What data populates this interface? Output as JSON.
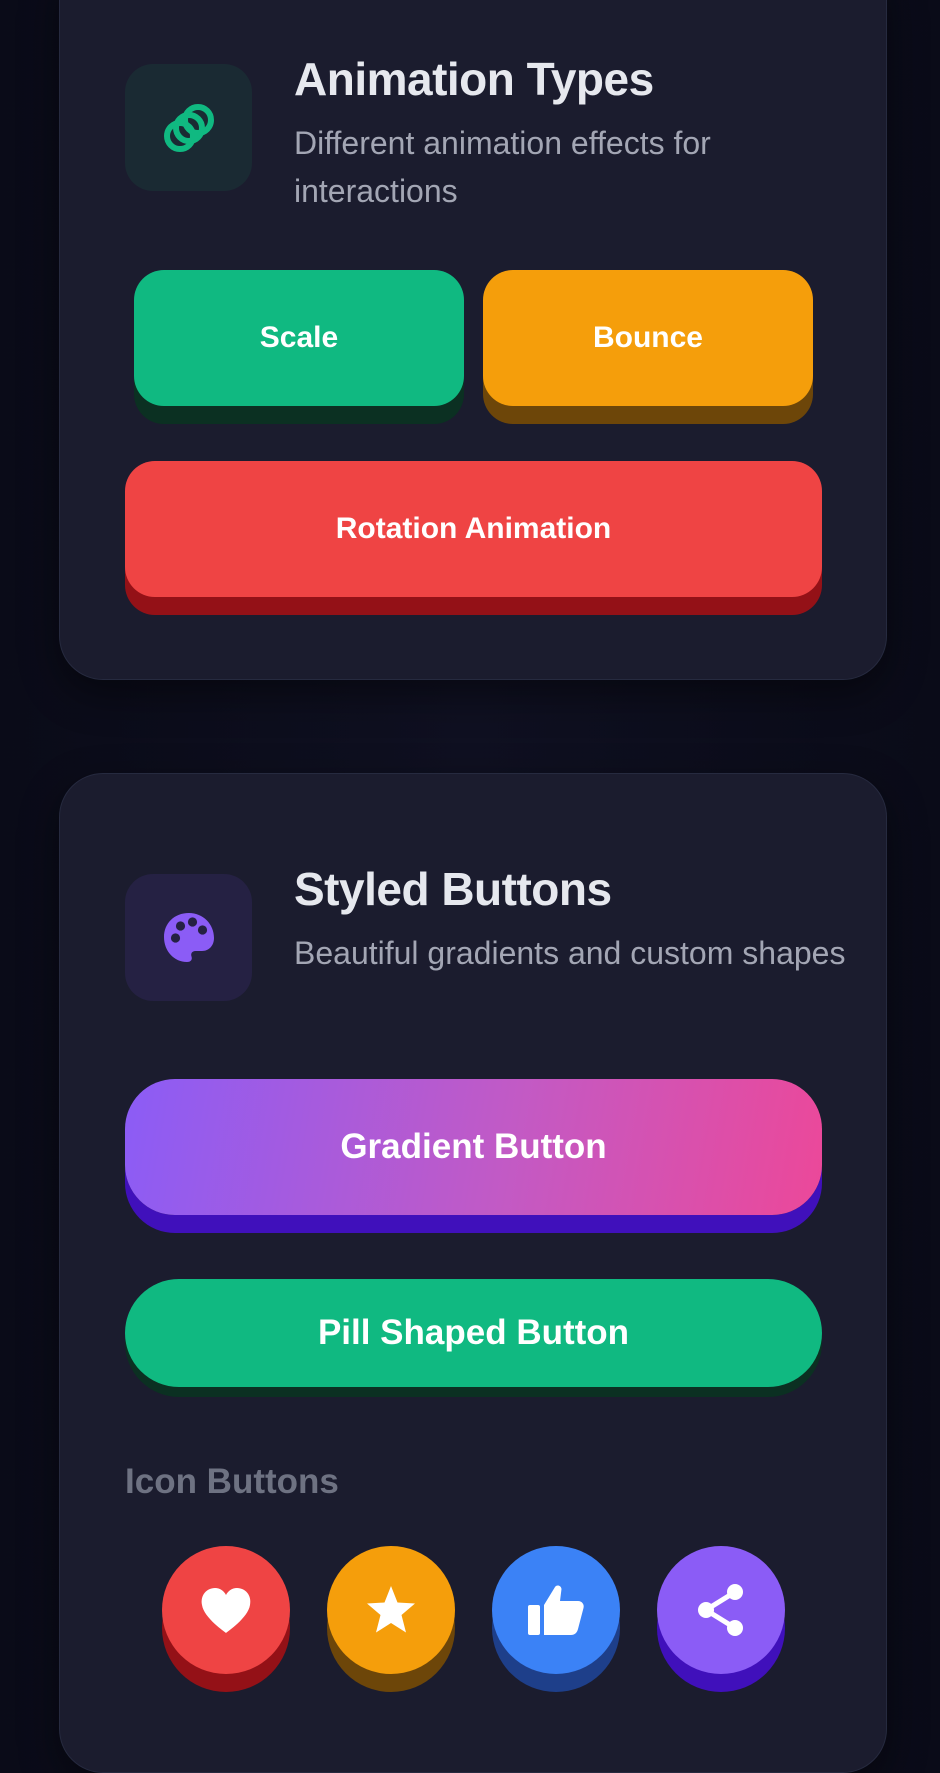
{
  "animation_card": {
    "icon": "rings-icon",
    "title": "Animation Types",
    "subtitle": "Different animation effects for interactions",
    "buttons": {
      "scale": "Scale",
      "bounce": "Bounce",
      "rotation": "Rotation Animation"
    }
  },
  "styled_card": {
    "icon": "palette-icon",
    "title": "Styled Buttons",
    "subtitle": "Beautiful gradients and custom shapes",
    "buttons": {
      "gradient": "Gradient Button",
      "pill": "Pill Shaped Button"
    },
    "icon_buttons_label": "Icon Buttons",
    "icon_buttons": [
      {
        "icon": "heart-icon",
        "color": "#ef4444"
      },
      {
        "icon": "star-icon",
        "color": "#f59e0b"
      },
      {
        "icon": "thumbs-up-icon",
        "color": "#3b82f6"
      },
      {
        "icon": "share-icon",
        "color": "#8b5cf6"
      }
    ]
  },
  "colors": {
    "background": "#0f1021",
    "card": "#1b1c2e",
    "green": "#10b981",
    "orange": "#f59e0b",
    "red": "#ef4444",
    "purple": "#8b5cf6",
    "pink": "#ec4899",
    "blue": "#3b82f6"
  }
}
